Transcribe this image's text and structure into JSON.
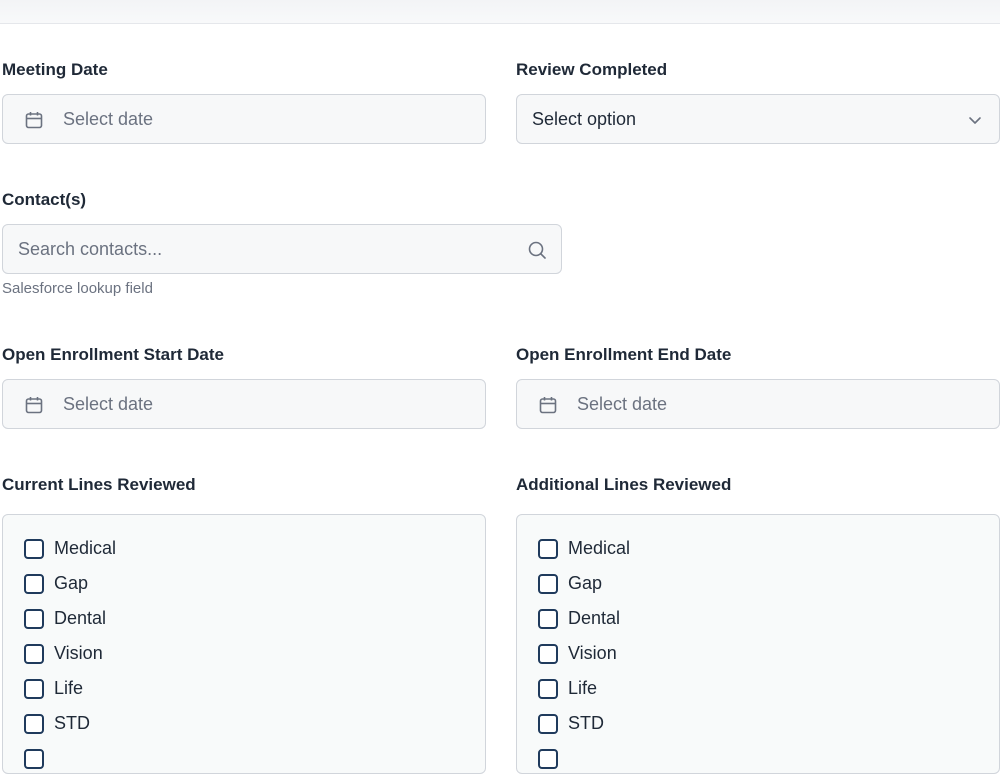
{
  "form": {
    "meeting_date": {
      "label": "Meeting Date",
      "placeholder": "Select date"
    },
    "review_completed": {
      "label": "Review Completed",
      "value": "Select option"
    },
    "contacts": {
      "label": "Contact(s)",
      "placeholder": "Search contacts...",
      "helper": "Salesforce lookup field"
    },
    "oe_start": {
      "label": "Open Enrollment Start Date",
      "placeholder": "Select date"
    },
    "oe_end": {
      "label": "Open Enrollment End Date",
      "placeholder": "Select date"
    },
    "current_lines": {
      "label": "Current Lines Reviewed",
      "items": [
        {
          "label": "Medical",
          "checked": false
        },
        {
          "label": "Gap",
          "checked": false
        },
        {
          "label": "Dental",
          "checked": false
        },
        {
          "label": "Vision",
          "checked": false
        },
        {
          "label": "Life",
          "checked": false
        },
        {
          "label": "STD",
          "checked": false
        }
      ]
    },
    "additional_lines": {
      "label": "Additional Lines Reviewed",
      "items": [
        {
          "label": "Medical",
          "checked": false
        },
        {
          "label": "Gap",
          "checked": false
        },
        {
          "label": "Dental",
          "checked": false
        },
        {
          "label": "Vision",
          "checked": false
        },
        {
          "label": "Life",
          "checked": false
        },
        {
          "label": "STD",
          "checked": false
        }
      ]
    }
  },
  "icons": {
    "date": "calendar-icon",
    "select": "chevron-down-icon",
    "search": "search-icon"
  }
}
